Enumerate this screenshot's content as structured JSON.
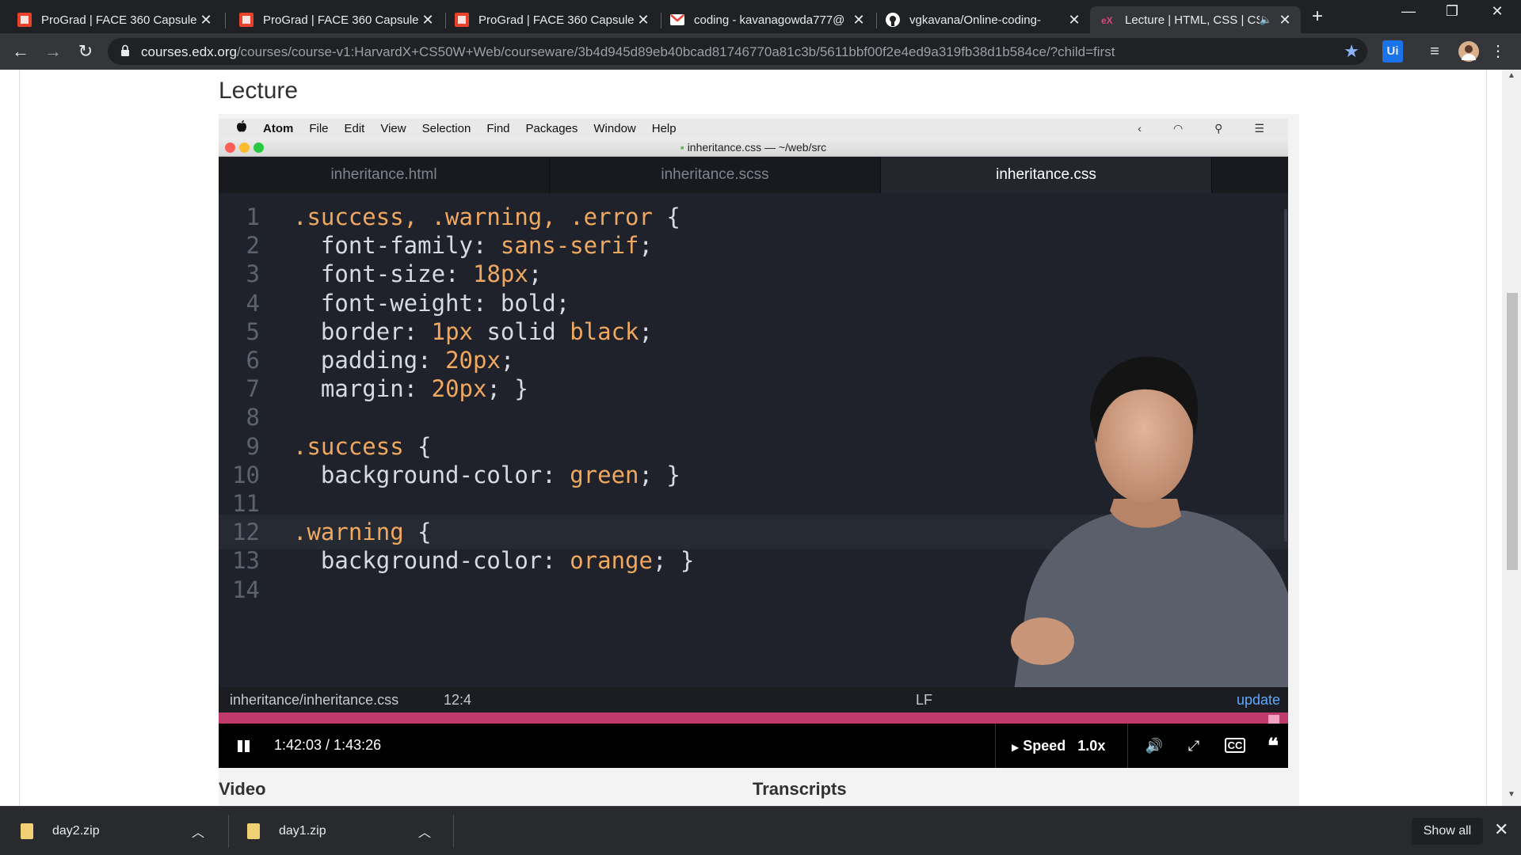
{
  "tabs": [
    {
      "title": "ProGrad | FACE 360 Capsule |",
      "icon": "prograd-icon"
    },
    {
      "title": "ProGrad | FACE 360 Capsule |",
      "icon": "prograd-icon"
    },
    {
      "title": "ProGrad | FACE 360 Capsule |",
      "icon": "prograd-icon"
    },
    {
      "title": "coding - kavanagowda777@",
      "icon": "gmail-icon"
    },
    {
      "title": "vgkavana/Online-coding-",
      "icon": "github-icon"
    },
    {
      "title": "Lecture | HTML, CSS | CS",
      "icon": "edx-icon",
      "active": true
    }
  ],
  "toolbar": {
    "url_host": "courses.edx.org",
    "url_path": "/courses/course-v1:HarvardX+CS50W+Web/courseware/3b4d945d89eb40bcad81746770a81c3b/5611bbf00f2e4ed9a319fb38d1b584ce/?child=first",
    "ext_label": "Ui"
  },
  "page": {
    "title": "Lecture",
    "video_label": "Video",
    "transcripts_label": "Transcripts"
  },
  "video": {
    "mac_menu": [
      "Atom",
      "File",
      "Edit",
      "View",
      "Selection",
      "Find",
      "Packages",
      "Window",
      "Help"
    ],
    "window_title": "inheritance.css — ~/web/src",
    "editor_tabs": [
      "inheritance.html",
      "inheritance.scss",
      "inheritance.css"
    ],
    "active_editor_tab": 2,
    "code_lines": [
      {
        "n": "1",
        "parts": [
          {
            "t": ".success, .warning, .error",
            "c": "sel"
          },
          {
            "t": " {",
            "c": ""
          }
        ]
      },
      {
        "n": "2",
        "parts": [
          {
            "t": "  font-family: ",
            "c": ""
          },
          {
            "t": "sans-serif",
            "c": "val"
          },
          {
            "t": ";",
            "c": ""
          }
        ]
      },
      {
        "n": "3",
        "parts": [
          {
            "t": "  font-size: ",
            "c": ""
          },
          {
            "t": "18px",
            "c": "val"
          },
          {
            "t": ";",
            "c": ""
          }
        ]
      },
      {
        "n": "4",
        "parts": [
          {
            "t": "  font-weight: bold;",
            "c": ""
          }
        ]
      },
      {
        "n": "5",
        "parts": [
          {
            "t": "  border: ",
            "c": ""
          },
          {
            "t": "1px",
            "c": "val"
          },
          {
            "t": " solid ",
            "c": ""
          },
          {
            "t": "black",
            "c": "val"
          },
          {
            "t": ";",
            "c": ""
          }
        ]
      },
      {
        "n": "6",
        "parts": [
          {
            "t": "  padding: ",
            "c": ""
          },
          {
            "t": "20px",
            "c": "val"
          },
          {
            "t": ";",
            "c": ""
          }
        ]
      },
      {
        "n": "7",
        "parts": [
          {
            "t": "  margin: ",
            "c": ""
          },
          {
            "t": "20px",
            "c": "val"
          },
          {
            "t": "; }",
            "c": ""
          }
        ]
      },
      {
        "n": "8",
        "parts": []
      },
      {
        "n": "9",
        "parts": [
          {
            "t": ".success",
            "c": "sel"
          },
          {
            "t": " {",
            "c": ""
          }
        ]
      },
      {
        "n": "10",
        "parts": [
          {
            "t": "  background-color: ",
            "c": ""
          },
          {
            "t": "green",
            "c": "val"
          },
          {
            "t": "; }",
            "c": ""
          }
        ]
      },
      {
        "n": "11",
        "parts": []
      },
      {
        "n": "12",
        "parts": [
          {
            "t": ".warning",
            "c": "sel"
          },
          {
            "t": " {",
            "c": ""
          }
        ],
        "current": true
      },
      {
        "n": "13",
        "parts": [
          {
            "t": "  background-color: ",
            "c": ""
          },
          {
            "t": "orange",
            "c": "val"
          },
          {
            "t": "; }",
            "c": ""
          }
        ]
      },
      {
        "n": "14",
        "parts": []
      }
    ],
    "status_file": "inheritance/inheritance.css",
    "status_pos": "12:4",
    "status_lf": "LF",
    "status_update": "update",
    "progress_fraction": 0.993,
    "time": "1:42:03 / 1:43:26",
    "speed_label": "Speed",
    "speed_value": "1.0x"
  },
  "downloads": [
    {
      "name": "day2.zip"
    },
    {
      "name": "day1.zip"
    }
  ],
  "shelf": {
    "show_all": "Show all"
  },
  "colors": {
    "progress": "#c03a6b",
    "accent": "#8ab4f8",
    "code_orange": "#f0a860"
  }
}
